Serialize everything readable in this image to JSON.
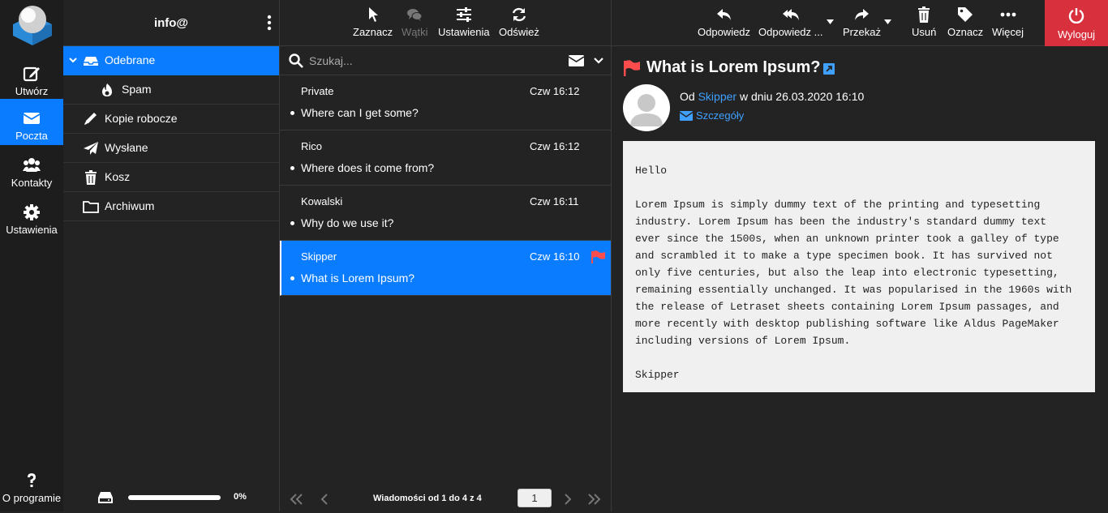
{
  "account": "info@",
  "rail": {
    "compose": "Utwórz",
    "mail": "Poczta",
    "contacts": "Kontakty",
    "settings": "Ustawienia",
    "about": "O programie"
  },
  "folders": [
    {
      "label": "Odebrane",
      "icon": "inbox-icon",
      "active": true
    },
    {
      "label": "Spam",
      "icon": "fire-icon"
    },
    {
      "label": "Kopie robocze",
      "icon": "pencil-icon"
    },
    {
      "label": "Wysłane",
      "icon": "paper-plane-icon"
    },
    {
      "label": "Kosz",
      "icon": "trash-icon"
    },
    {
      "label": "Archiwum",
      "icon": "folder-icon"
    }
  ],
  "quota": {
    "value": "0%",
    "fraction": 0
  },
  "list_toolbar": {
    "select": "Zaznacz",
    "threads": "Wątki",
    "options": "Ustawienia",
    "refresh": "Odśwież"
  },
  "search": {
    "placeholder": "Szukaj..."
  },
  "messages": [
    {
      "from": "Private",
      "date": "Czw 16:12",
      "subject": "Where can I get some?"
    },
    {
      "from": "Rico",
      "date": "Czw 16:12",
      "subject": "Where does it come from?"
    },
    {
      "from": "Kowalski",
      "date": "Czw 16:11",
      "subject": "Why do we use it?"
    },
    {
      "from": "Skipper",
      "date": "Czw 16:10",
      "subject": "What is Lorem Ipsum?",
      "flagged": true,
      "selected": true
    }
  ],
  "pager": {
    "text": "Wiadomości od 1 do 4 z 4",
    "page": "1"
  },
  "preview_toolbar": {
    "reply": "Odpowiedz",
    "reply_all": "Odpowiedz ...",
    "forward": "Przekaż",
    "delete": "Usuń",
    "mark": "Oznacz",
    "more": "Więcej",
    "logout": "Wyloguj"
  },
  "message": {
    "subject": "What is Lorem Ipsum?",
    "from_prefix": "Od",
    "sender": "Skipper",
    "date_text": "w dniu 26.03.2020 16:10",
    "details": "Szczegóły",
    "body": "Hello\n\nLorem Ipsum is simply dummy text of the printing and typesetting\nindustry. Lorem Ipsum has been the industry's standard dummy text\never since the 1500s, when an unknown printer took a galley of type\nand scrambled it to make a type specimen book. It has survived not\nonly five centuries, but also the leap into electronic typesetting,\nremaining essentially unchanged. It was popularised in the 1960s with\nthe release of Letraset sheets containing Lorem Ipsum passages, and\nmore recently with desktop publishing software like Aldus PageMaker\nincluding versions of Lorem Ipsum.\n\nSkipper"
  },
  "colors": {
    "accent": "#0a7cff",
    "logout": "#d9303e",
    "flag": "#ff4d4d",
    "link": "#3fa0ff"
  }
}
